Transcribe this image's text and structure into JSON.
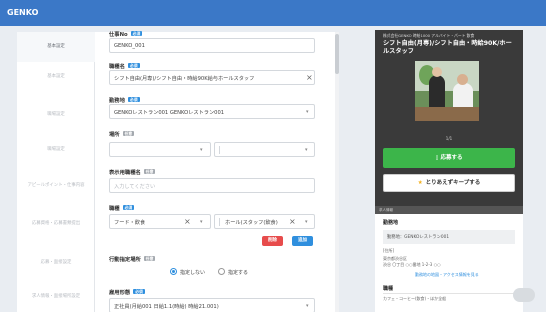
{
  "app": {
    "title": "GENKO"
  },
  "sidebar": {
    "items": [
      {
        "label": "基本設定"
      },
      {
        "label": "基本設定"
      },
      {
        "label": "職場設定"
      },
      {
        "label": "職場設定"
      },
      {
        "label": "アピールポイント・仕事内容"
      },
      {
        "label": "応募資格・応募書類提出"
      },
      {
        "label": "応募・面接設定"
      },
      {
        "label": "求人情報・面接場所設定"
      }
    ]
  },
  "form": {
    "job_no": {
      "label": "仕事No",
      "badge": "必須",
      "value": "GENKO_001"
    },
    "job_title": {
      "label": "職種名",
      "badge": "必須",
      "value": "シフト自由(月専)/シフト自由・時給90K給与ホールスタッフ"
    },
    "workplace": {
      "label": "勤務地",
      "badge": "必須",
      "value": "GENKOレストラン001 GENKOレストラン001"
    },
    "location": {
      "label": "場所",
      "badge": "任意",
      "value": ""
    },
    "display_title": {
      "label": "表示用職種名",
      "badge": "任意",
      "placeholder": "入力してください"
    },
    "category": {
      "label": "職種",
      "badge": "必須",
      "value1": "フード・飲食",
      "value2": "ホール(スタッフ(飲食)"
    },
    "buttons": {
      "delete": "削除",
      "add": "追加"
    },
    "promo": {
      "label": "行動指定場所",
      "badge": "任意",
      "options": [
        {
          "label": "指定しない",
          "checked": true
        },
        {
          "label": "指定する",
          "checked": false
        }
      ]
    },
    "employment": {
      "label": "雇用形態",
      "badge": "必須",
      "value": "正社員(月給001 日給1.1(時給) 時給21.001)"
    }
  },
  "preview": {
    "company": "株式会社GENKO 時給1000 アルバイト・パート 飲食",
    "title": "シフト自由(月専)/シフト自由・時給90K/ホールスタッフ",
    "counter": "1/1",
    "apply_label": "応募する",
    "keep_label": "とりあえずキープする",
    "section_bar": "求人情報",
    "workplace_heading": "勤務地",
    "workplace_value": "勤務地：GENKOレストラン001",
    "detail_label": "[住所]",
    "address_line1": "東京都渋谷区",
    "address_line2": "渋谷 〇丁目 ○○番地 1-2-3 ○○",
    "map_link": "勤務地の地図・アクセス情報を見る",
    "job_heading": "職種",
    "job_value": "カフェ・コーヒー(飲食)・ほか全般"
  }
}
